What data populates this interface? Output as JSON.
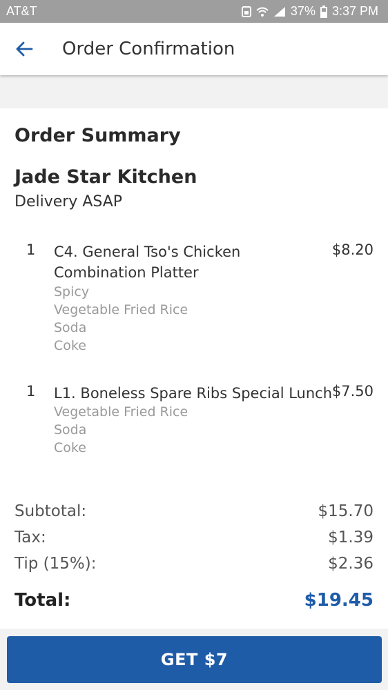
{
  "status_bar": {
    "carrier": "AT&T",
    "battery": "37%",
    "time": "3:37 PM"
  },
  "header": {
    "title": "Order Confirmation",
    "back_icon": "arrow-left-icon"
  },
  "summary": {
    "heading": "Order Summary",
    "restaurant": "Jade Star Kitchen",
    "delivery": "Delivery ASAP"
  },
  "items": [
    {
      "qty": "1",
      "name": "C4. General Tso's Chicken Combination Platter",
      "price": "$8.20",
      "mods": [
        "Spicy",
        "Vegetable Fried Rice",
        "Soda",
        "Coke"
      ]
    },
    {
      "qty": "1",
      "name": "L1. Boneless Spare Ribs Special Lunch",
      "price": "$7.50",
      "mods": [
        "Vegetable Fried Rice",
        "Soda",
        "Coke"
      ]
    }
  ],
  "totals": {
    "subtotal_label": "Subtotal:",
    "subtotal": "$15.70",
    "tax_label": "Tax:",
    "tax": "$1.39",
    "tip_label": "Tip (15%):",
    "tip": "$2.36",
    "total_label": "Total:",
    "total": "$19.45"
  },
  "cta": {
    "label": "GET $7"
  },
  "colors": {
    "accent": "#1f5ca8",
    "status_bar": "#9e9e9e"
  }
}
